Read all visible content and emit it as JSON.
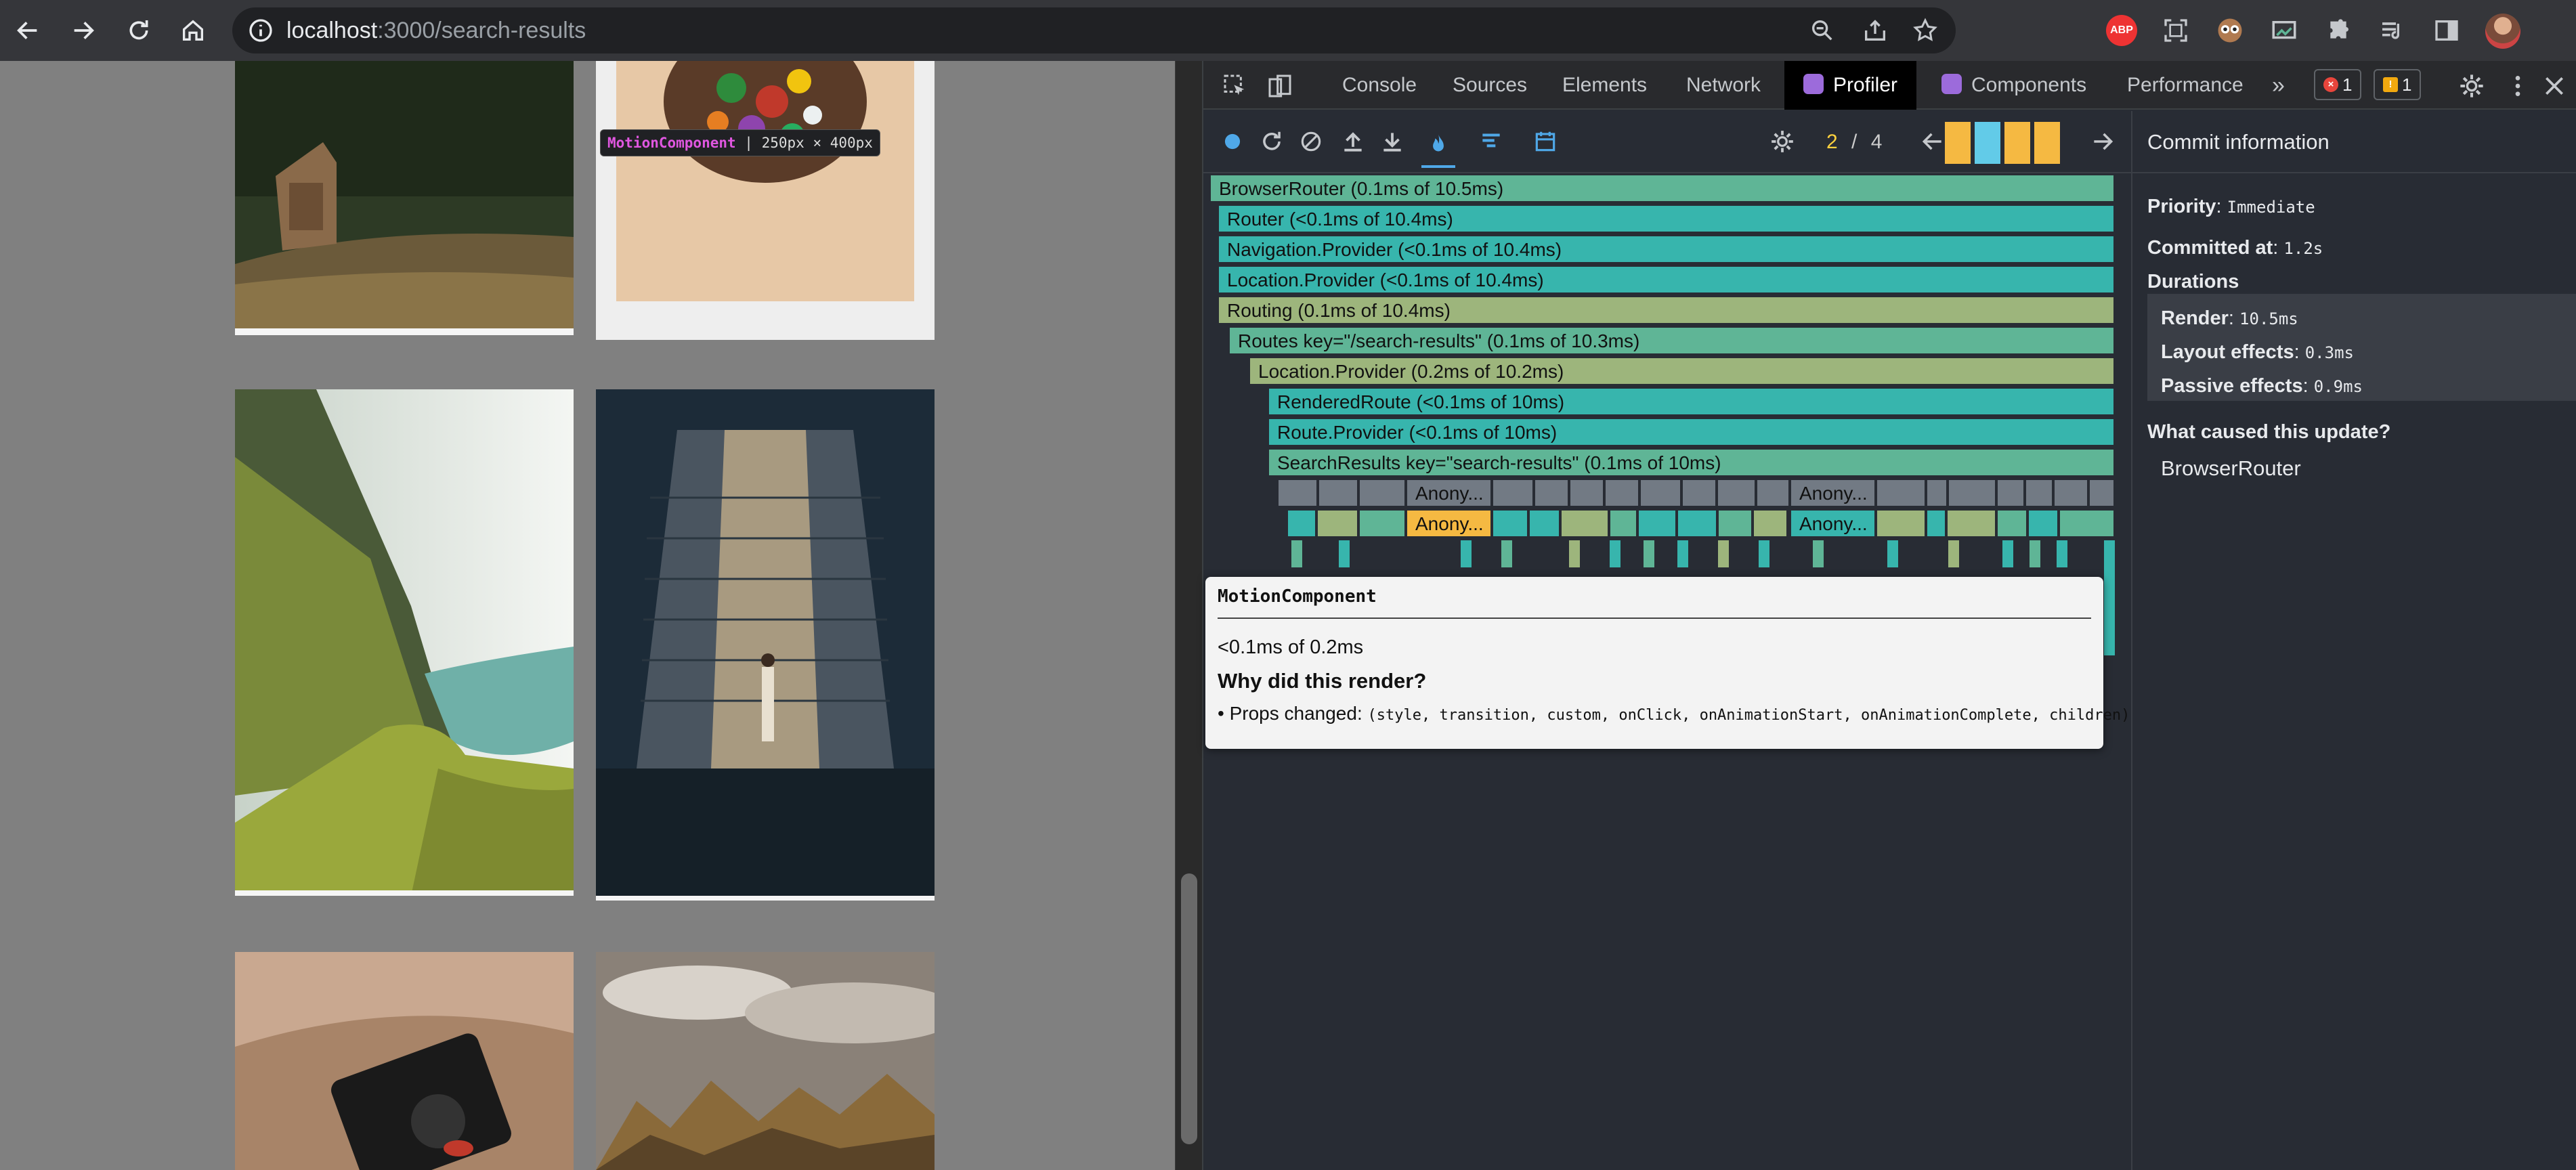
{
  "browser": {
    "url_host": "localhost",
    "url_path": ":3000/search-results",
    "extension_abp_label": "ABP"
  },
  "page": {
    "motion_component_label": "MotionComponent",
    "motion_component_size": "250px × 400px"
  },
  "devtools": {
    "tabs": [
      "Console",
      "Sources",
      "Elements",
      "Network",
      "Profiler",
      "Components",
      "Performance"
    ],
    "active_tab": "Profiler",
    "more_tabs": "»",
    "error_count": "1",
    "warning_count": "1"
  },
  "profiler": {
    "commit_current": "2",
    "commit_separator": "/",
    "commit_total": "4",
    "commit_bars": [
      0.6,
      0.6,
      0.6,
      0.6
    ],
    "selected_commit_index": 1,
    "flame_bars": [
      {
        "label": "BrowserRouter (0.1ms of 10.5ms)",
        "color": "#5fb596"
      },
      {
        "label": "Router (<0.1ms of 10.4ms)",
        "color": "#37b5ad"
      },
      {
        "label": "Navigation.Provider (<0.1ms of 10.4ms)",
        "color": "#37b5ad"
      },
      {
        "label": "Location.Provider (<0.1ms of 10.4ms)",
        "color": "#37b5ad"
      },
      {
        "label": "Routing (0.1ms of 10.4ms)",
        "color": "#9db57c"
      },
      {
        "label": "Routes key=\"/search-results\" (0.1ms of 10.3ms)",
        "color": "#5fb596"
      },
      {
        "label": "Location.Provider (0.2ms of 10.2ms)",
        "color": "#9db57c"
      },
      {
        "label": "RenderedRoute (<0.1ms of 10ms)",
        "color": "#37b5ad"
      },
      {
        "label": "Route.Provider (<0.1ms of 10ms)",
        "color": "#37b5ad"
      },
      {
        "label": "SearchResults key=\"search-results\" (0.1ms of 10ms)",
        "color": "#5fb596"
      }
    ],
    "anon_label": "Anony...",
    "anon_labels": [
      "Anony...",
      "Anony...",
      "Anony...",
      "Anony..."
    ]
  },
  "commit_info": {
    "header": "Commit information",
    "priority_label": "Priority",
    "priority_value": "Immediate",
    "committed_label": "Committed at",
    "committed_value": "1.2s",
    "durations_label": "Durations",
    "render_label": "Render",
    "render_value": "10.5ms",
    "layout_label": "Layout effects",
    "layout_value": "0.3ms",
    "passive_label": "Passive effects",
    "passive_value": "0.9ms",
    "cause_label": "What caused this update?",
    "cause_value": "BrowserRouter"
  },
  "tooltip": {
    "component": "MotionComponent",
    "time": "<0.1ms of 0.2ms",
    "why_label": "Why did this render?",
    "props_prefix": "• Props changed:",
    "props_list": "(style, transition, custom, onClick, onAnimationStart, onAnimationComplete, children)"
  }
}
